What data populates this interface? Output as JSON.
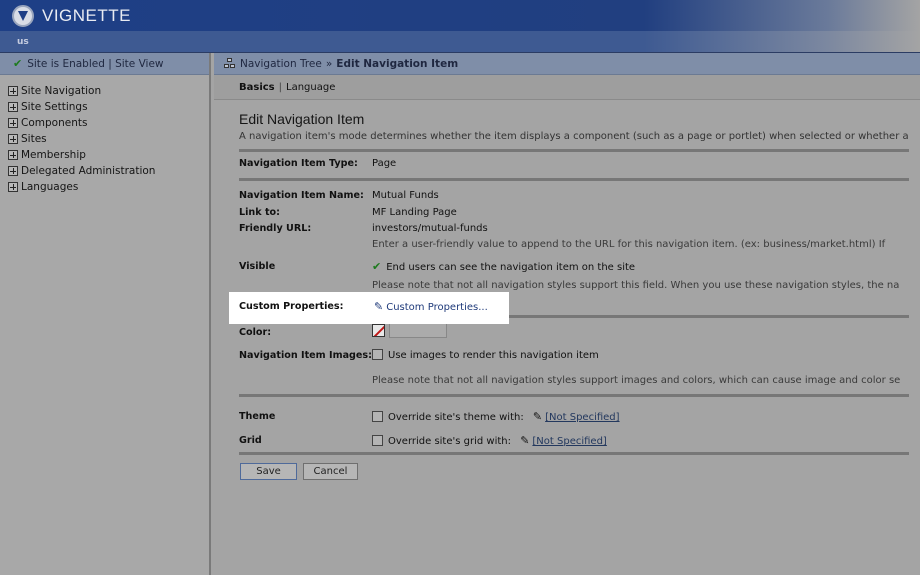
{
  "app": {
    "brand": "VIGNETTE",
    "user": "us"
  },
  "sidebar": {
    "status": "Site is Enabled | Site View",
    "items": [
      {
        "label": "Site Navigation"
      },
      {
        "label": "Site Settings"
      },
      {
        "label": "Components"
      },
      {
        "label": "Sites"
      },
      {
        "label": "Membership"
      },
      {
        "label": "Delegated Administration"
      },
      {
        "label": "Languages"
      }
    ]
  },
  "breadcrumb": {
    "parent": "Navigation Tree",
    "separator": "»",
    "current": "Edit Navigation Item"
  },
  "tabs": {
    "active": "Basics",
    "separator": "|",
    "other": "Language"
  },
  "form": {
    "title": "Edit Navigation Item",
    "description": "A navigation item's mode determines whether the item displays a component (such as a page or portlet) when selected or whether a",
    "type_label": "Navigation Item Type:",
    "type_value": "Page",
    "name_label": "Navigation Item Name:",
    "name_value": "Mutual Funds",
    "link_label": "Link to:",
    "link_value": "MF Landing Page",
    "url_label": "Friendly URL:",
    "url_value": "investors/mutual-funds",
    "url_hint": "Enter a user-friendly value to append to the URL for this navigation item. (ex: business/market.html) If",
    "visible_label": "Visible",
    "visible_value": "End users can see the navigation item on the site",
    "visible_hint": "Please note that not all navigation styles support this field. When you use these navigation styles, the na",
    "custom_label": "Custom Properties:",
    "custom_link": "Custom Properties...",
    "color_label": "Color:",
    "images_label": "Navigation Item Images:",
    "images_value": "Use images to render this navigation item",
    "images_hint": "Please note that not all navigation styles support images and colors, which can cause image and color se",
    "theme_label": "Theme",
    "theme_value": "Override site's theme with:",
    "theme_link": "[Not Specified]",
    "grid_label": "Grid",
    "grid_value": "Override site's grid with:",
    "grid_link": "[Not Specified]",
    "save_label": "Save",
    "cancel_label": "Cancel"
  }
}
